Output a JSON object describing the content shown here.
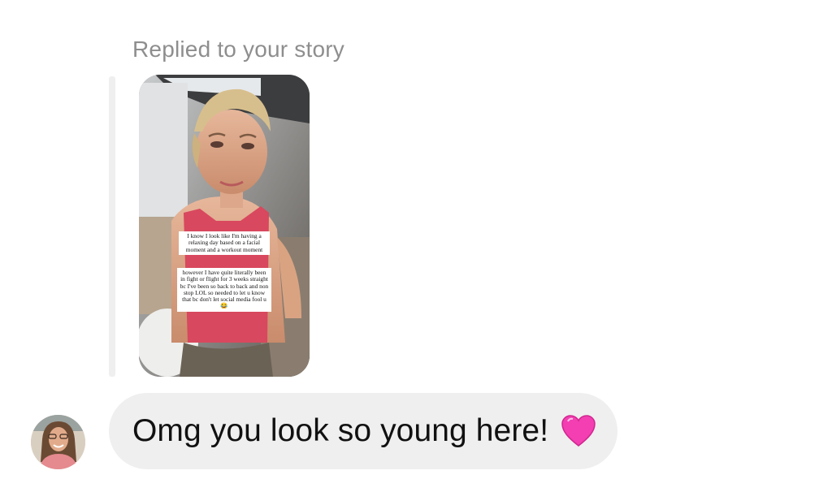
{
  "reply": {
    "label": "Replied to your story"
  },
  "story": {
    "caption_1": "I know I look like I'm having a relaxing day based on a facial moment and a workout moment",
    "caption_2": "however I have quite literally been in fight or flight for 3 weeks straight bc I've been so back to back and non stop LOL so needed to let u know that bc don't let social media fool u 😂"
  },
  "message": {
    "text": "Omg you look so young here!",
    "emoji_icon": "pink-heart-icon"
  },
  "colors": {
    "label_gray": "#8e8e8e",
    "bubble_bg": "#efefef",
    "reply_bar": "#efefef",
    "heart_pink": "#f33fb2"
  }
}
